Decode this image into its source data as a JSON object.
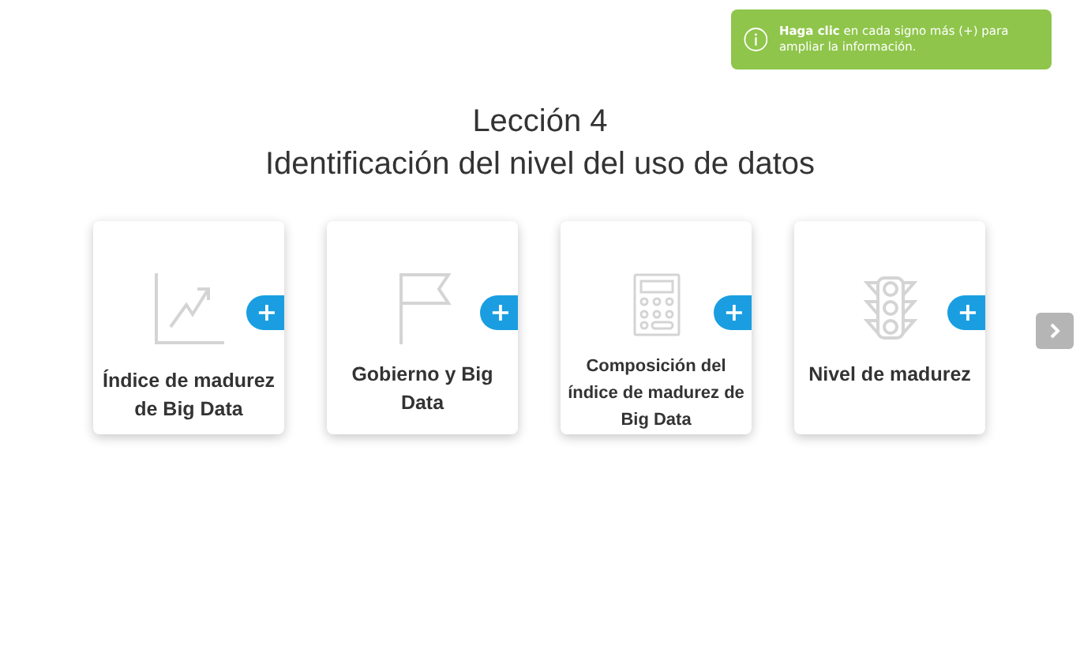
{
  "notice": {
    "lead": "Haga clic",
    "text": "en cada signo más (+) para ampliar la información."
  },
  "title": [
    "Lección 4",
    "Identificación del nivel del uso de datos"
  ],
  "cards": [
    {
      "kind": "chart",
      "label": "Índice de madurez de Big Data",
      "expand": "+"
    },
    {
      "kind": "flag",
      "label": "Gobierno y Big Data",
      "expand": "+"
    },
    {
      "kind": "calculator",
      "label": "Composición del índice de madurez de Big Data",
      "expand": "+"
    },
    {
      "kind": "traffic-light",
      "label": "Nivel de madurez",
      "expand": "+"
    }
  ]
}
